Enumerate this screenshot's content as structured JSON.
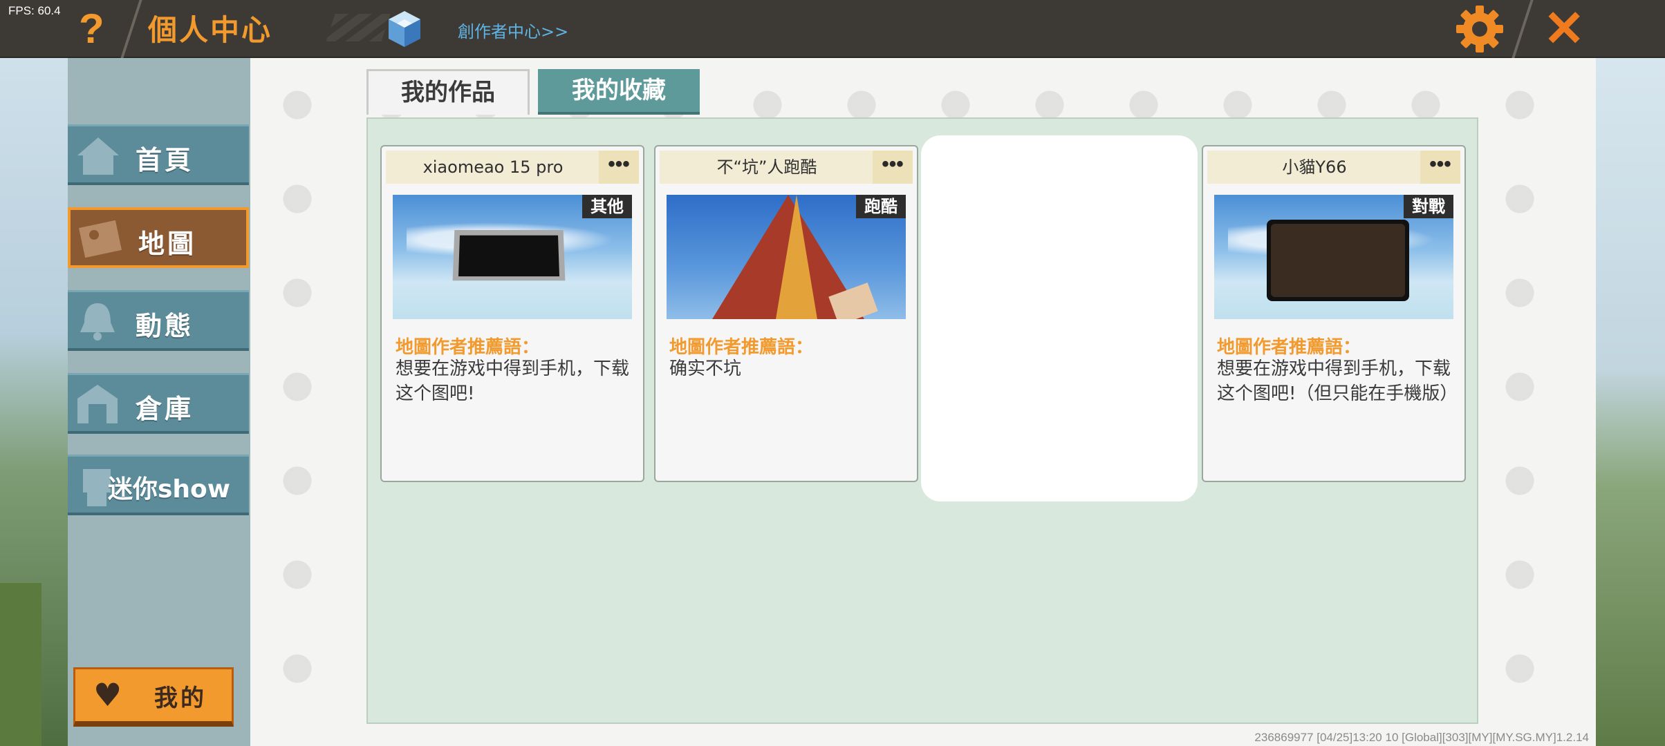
{
  "topbar": {
    "fps": "FPS: 60.4",
    "help_icon": "question-mark",
    "title": "個人中心",
    "creator_link": "創作者中心>>",
    "settings_icon": "gear",
    "close_icon": "close-x"
  },
  "sidebar": {
    "items": [
      {
        "label": "首頁",
        "icon": "home-icon",
        "active": false
      },
      {
        "label": "地圖",
        "icon": "map-icon",
        "active": true
      },
      {
        "label": "動態",
        "icon": "bell-icon",
        "active": false
      },
      {
        "label": "倉庫",
        "icon": "warehouse-icon",
        "active": false
      },
      {
        "label": "迷你show",
        "icon": "character-icon",
        "active": false
      }
    ],
    "mine_label": "我的"
  },
  "tabs": [
    {
      "label": "我的作品",
      "active": true
    },
    {
      "label": "我的收藏",
      "active": false
    }
  ],
  "cards": [
    {
      "name": "xiaomeao 15 pro",
      "tag": "其他",
      "intro_label": "地圖作者推薦語：",
      "intro_text": "想要在游戏中得到手机，下载这个图吧!"
    },
    {
      "name": "不“坑”人跑酷",
      "tag": "跑酷",
      "intro_label": "地圖作者推薦語：",
      "intro_text": "确实不坑"
    },
    {
      "name": "小貓Y66",
      "tag": "對戰",
      "intro_label": "地圖作者推薦語：",
      "intro_text": "想要在游戏中得到手机，下载这个图吧!（但只能在手機版）"
    }
  ],
  "more_label": "•••",
  "footer": "236869977   [04/25]13:20 10  [Global][303][MY][MY.SG.MY]1.2.14",
  "colors": {
    "accent_orange": "#f29a2e",
    "topbar_bg": "#3d3a35",
    "sidebar_item": "#5c8c9a",
    "content_bg": "#d8e8dc",
    "tab_inactive": "#5e9a9a"
  }
}
